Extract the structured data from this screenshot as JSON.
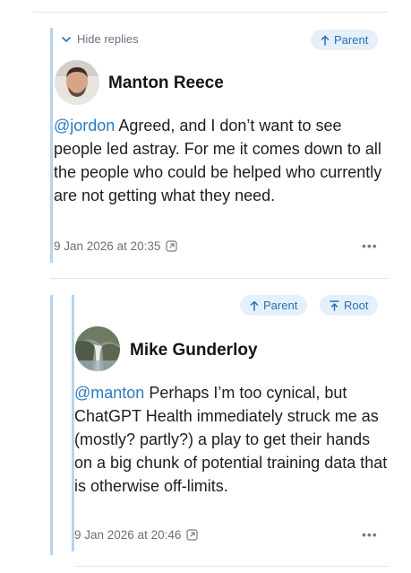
{
  "thread": {
    "hide_replies": "Hide replies",
    "parent_label": "Parent",
    "root_label": "Root"
  },
  "posts": [
    {
      "author": "Manton Reece",
      "mention": "@jordon",
      "text": " Agreed, and I don’t want to see people led astray. For me it comes down to all the people who  could be helped who currently are not getting what they need.",
      "timestamp": "9 Jan 2026 at 20:35",
      "more": "•••"
    },
    {
      "author": "Mike Gunderloy",
      "mention": "@manton",
      "text": " Perhaps I’m too cynical, but ChatGPT Health immediately struck me as (mostly? partly?) a play to get their hands on a big chunk of potential training data that is otherwise off-limits.",
      "timestamp": "9 Jan 2026 at 20:46",
      "more": "•••"
    }
  ],
  "colors": {
    "accent": "#2a7ac2",
    "rail": "#b8d3ee",
    "pill_bg": "#e6f0fa"
  },
  "icons": [
    "chevron-down-icon",
    "arrow-up-icon",
    "arrow-up-bar-icon",
    "external-link-icon",
    "more-icon"
  ]
}
